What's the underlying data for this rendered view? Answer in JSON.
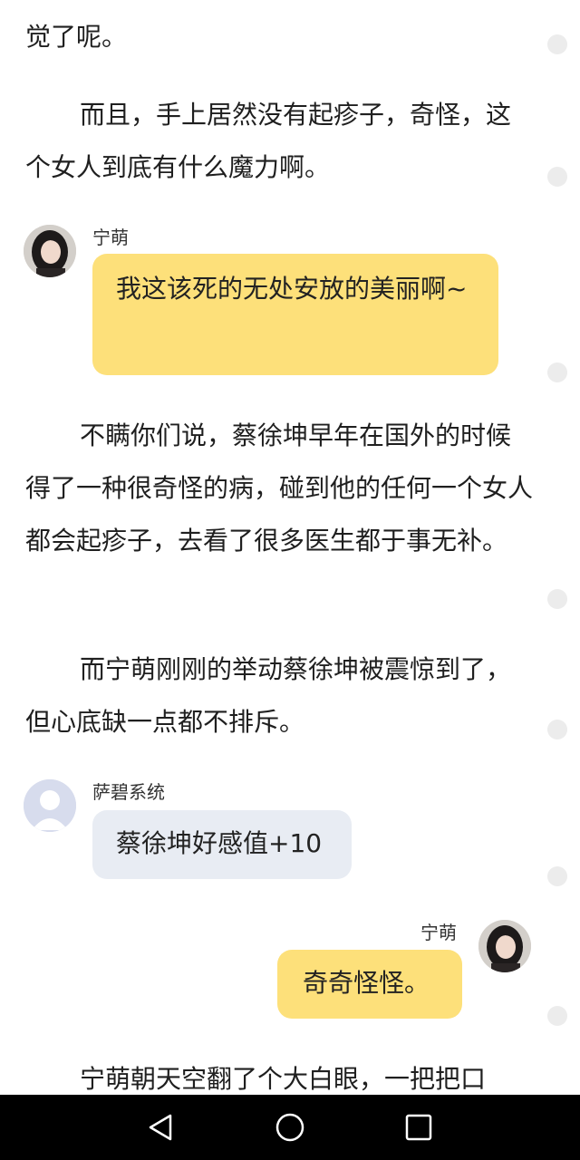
{
  "paragraphs": {
    "p1": "觉了呢。",
    "p2": "而且，手上居然没有起疹子，奇怪，这个女人到底有什么魔力啊。",
    "p3": "不瞒你们说，蔡徐坤早年在国外的时候得了一种很奇怪的病，碰到他的任何一个女人都会起疹子，去看了很多医生都于事无补。",
    "p4": "而宁萌刚刚的举动蔡徐坤被震惊到了，但心底缺一点都不排斥。",
    "p5": "宁萌朝天空翻了个大白眼，一把把口"
  },
  "messages": {
    "m1": {
      "sender": "宁萌",
      "text": "我这该死的无处安放的美丽啊~"
    },
    "m2": {
      "sender": "萨碧系统",
      "text": "蔡徐坤好感值+10"
    },
    "m3": {
      "sender": "宁萌",
      "text": "奇奇怪怪。"
    }
  },
  "icons": {
    "avatar_girl": "girl-avatar-icon",
    "avatar_system": "person-placeholder-icon",
    "nav_back": "back-triangle-icon",
    "nav_home": "home-circle-icon",
    "nav_recents": "recents-square-icon"
  },
  "colors": {
    "bubble_yellow": "#fde07a",
    "bubble_gray": "#e8ecf3",
    "navbar": "#000000"
  }
}
